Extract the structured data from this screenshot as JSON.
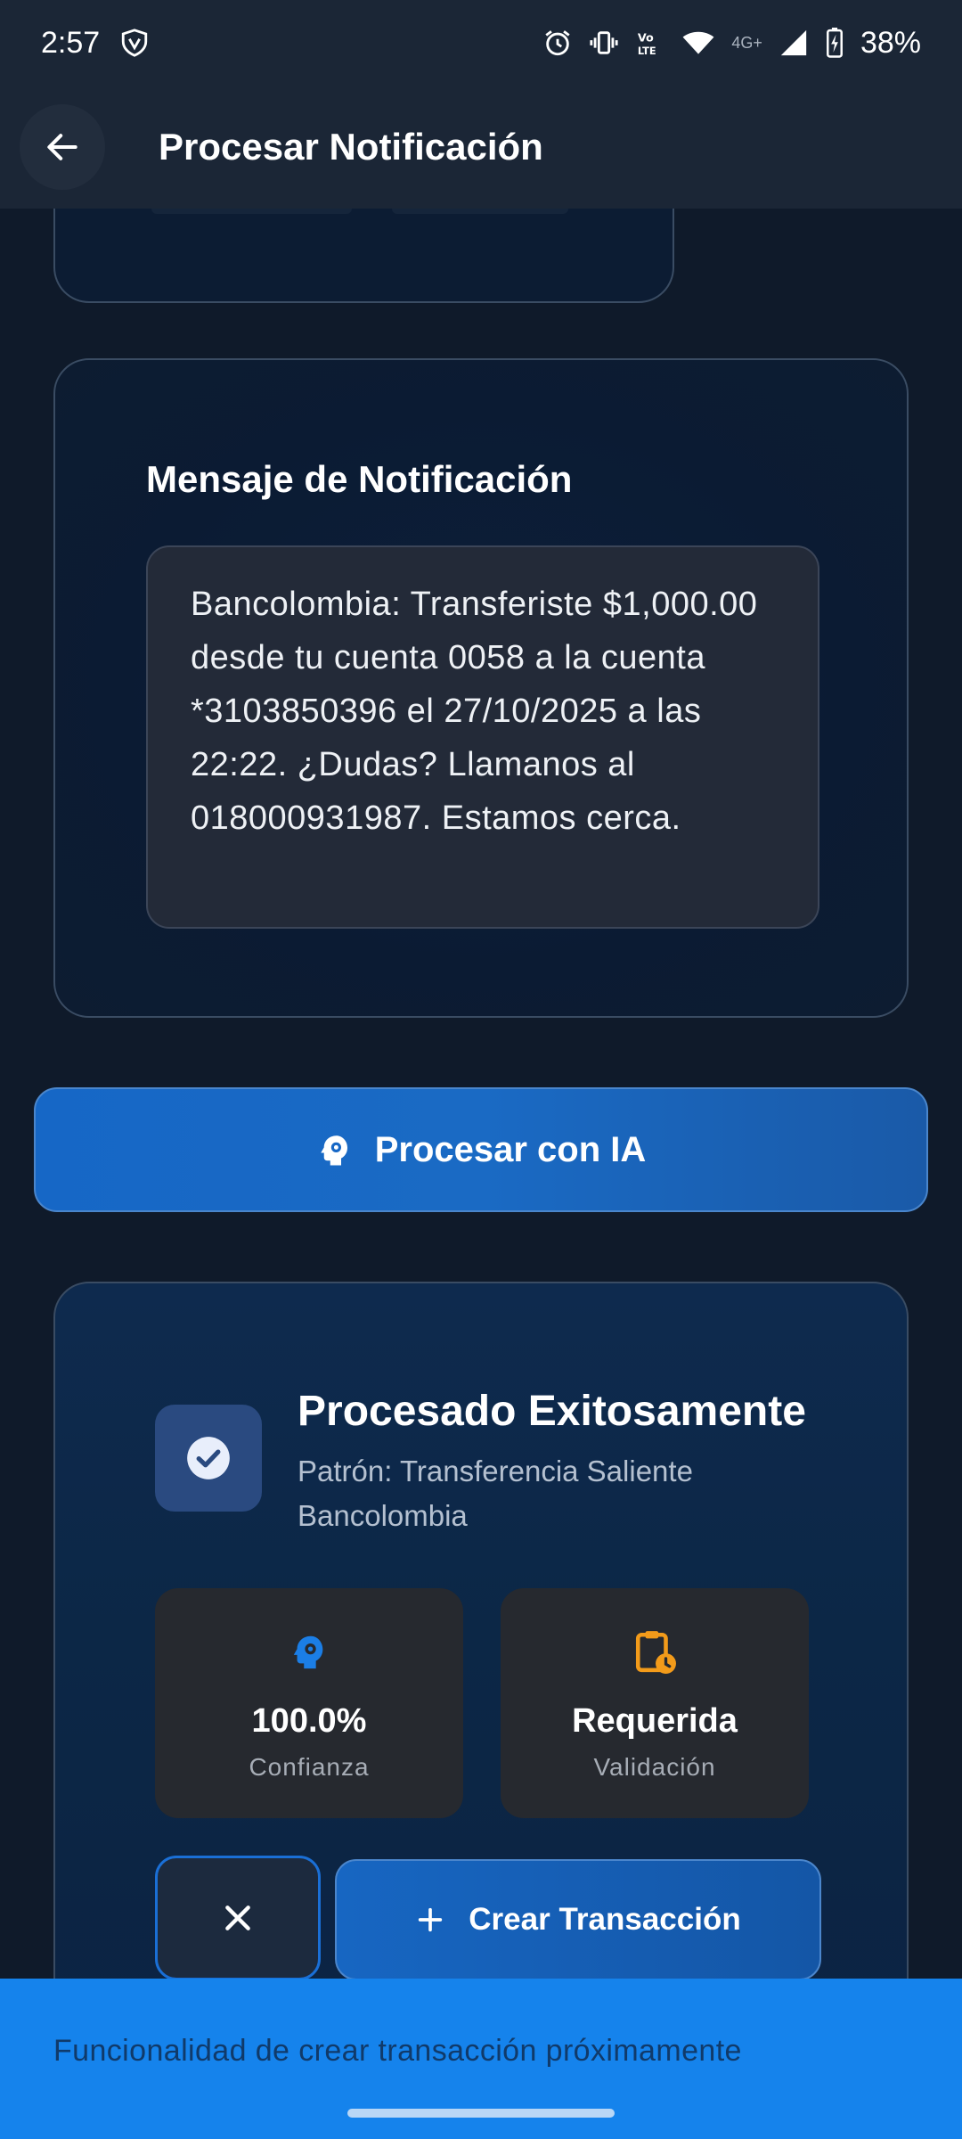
{
  "status_bar": {
    "time": "2:57",
    "network_label": "4G+",
    "battery": "38%"
  },
  "app_bar": {
    "title": "Procesar Notificación"
  },
  "message_card": {
    "title": "Mensaje de Notificación",
    "body": "Bancolombia: Transferiste $1,000.00 desde tu cuenta 0058 a la cuenta *3103850396 el 27/10/2025 a las 22:22. ¿Dudas? Llamanos al 018000931987. Estamos cerca."
  },
  "process_button": {
    "label": "Procesar con IA"
  },
  "result_card": {
    "title": "Procesado Exitosamente",
    "pattern": "Patrón: Transferencia Saliente Bancolombia",
    "stats": [
      {
        "value": "100.0%",
        "label": "Confianza",
        "icon": "psychology-icon",
        "color": "#1b7ee6"
      },
      {
        "value": "Requerida",
        "label": "Validación",
        "icon": "pending-actions-icon",
        "color": "#f39b1a"
      }
    ],
    "create_button_label": "Crear Transacción"
  },
  "snackbar": {
    "message": "Funcionalidad de crear transacción próximamente"
  },
  "colors": {
    "background": "#0f1a2a",
    "primary": "#1766c2",
    "snackbar": "#1583ec",
    "accent_orange": "#f39b1a"
  }
}
